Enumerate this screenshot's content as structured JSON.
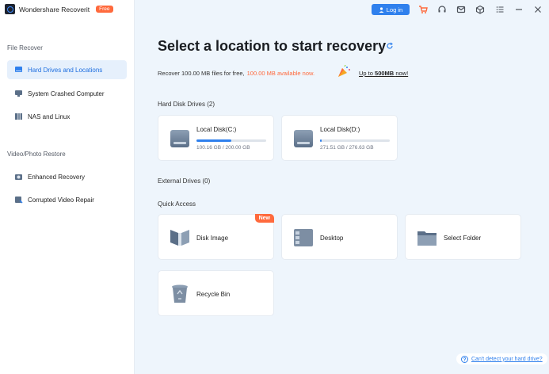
{
  "app": {
    "title": "Wondershare Recoverit",
    "badge": "Free"
  },
  "topbar": {
    "login_label": "Log in",
    "icons": [
      "cart-icon",
      "headset-icon",
      "mail-icon",
      "cube-icon",
      "menu-list-icon",
      "minimize-icon",
      "close-icon"
    ]
  },
  "sidebar": {
    "section_file_recover": "File Recover",
    "items_file": [
      {
        "label": "Hard Drives and Locations",
        "icon": "hard-drive-icon",
        "active": true
      },
      {
        "label": "System Crashed Computer",
        "icon": "monitor-icon",
        "active": false
      },
      {
        "label": "NAS and Linux",
        "icon": "nas-icon",
        "active": false
      }
    ],
    "section_video": "Video/Photo Restore",
    "items_video": [
      {
        "label": "Enhanced Recovery",
        "icon": "camera-icon"
      },
      {
        "label": "Corrupted Video Repair",
        "icon": "video-repair-icon"
      }
    ]
  },
  "main": {
    "title": "Select a location to start recovery",
    "promo_text": "Recover 100.00 MB files for free,",
    "promo_highlight": "100.00 MB available now.",
    "promo_link_prefix": "Up to",
    "promo_link_bold": "500MB",
    "promo_link_suffix": "now!",
    "hard_disk_label": "Hard Disk Drives (2)",
    "disks": [
      {
        "name": "Local Disk(C:)",
        "size": "100.16 GB / 200.00 GB",
        "used_fraction": 0.5
      },
      {
        "name": "Local Disk(D:)",
        "size": "271.51 GB / 276.63 GB",
        "used_fraction": 0.02
      }
    ],
    "external_label": "External Drives (0)",
    "quick_access_label": "Quick Access",
    "quick_access": [
      {
        "label": "Disk Image",
        "badge": "New"
      },
      {
        "label": "Desktop"
      },
      {
        "label": "Select Folder"
      },
      {
        "label": "Recycle Bin"
      }
    ],
    "help_link": "Can't detect your hard drive?"
  },
  "colors": {
    "accent": "#2f80ed",
    "highlight": "#ff6a3d",
    "background": "#eef5fc"
  }
}
